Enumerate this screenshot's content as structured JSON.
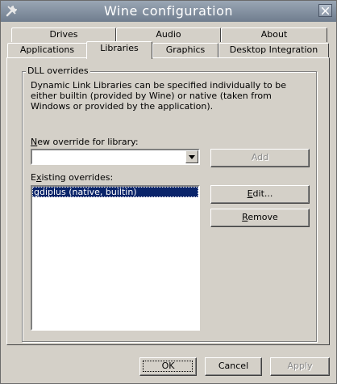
{
  "window": {
    "title": "Wine configuration",
    "app_icon": "wrench-icon",
    "close_icon": "close-icon"
  },
  "tabs": {
    "row1": [
      {
        "label": "Drives"
      },
      {
        "label": "Audio"
      },
      {
        "label": "About"
      }
    ],
    "row2": [
      {
        "label": "Applications"
      },
      {
        "label": "Libraries",
        "selected": true
      },
      {
        "label": "Graphics"
      },
      {
        "label": "Desktop Integration"
      }
    ]
  },
  "libraries": {
    "group_title": "DLL overrides",
    "description": "Dynamic Link Libraries can be specified individually to be either builtin (provided by Wine) or native (taken from Windows or provided by the application).",
    "new_override": {
      "label_accel": "N",
      "label_rest": "ew override for library:",
      "value": ""
    },
    "add_label": "Add",
    "existing": {
      "label_pre": "E",
      "label_accel": "x",
      "label_rest": "isting overrides:",
      "items": [
        "gdiplus (native, builtin)"
      ]
    },
    "edit_accel": "E",
    "edit_rest": "dit...",
    "remove_accel": "R",
    "remove_rest": "emove"
  },
  "footer": {
    "ok_label": "OK",
    "cancel_label": "Cancel",
    "apply_label": "Apply"
  },
  "colors": {
    "selection": "#0a246a",
    "face": "#d4d0c8",
    "titlebar": "#7b8899"
  }
}
